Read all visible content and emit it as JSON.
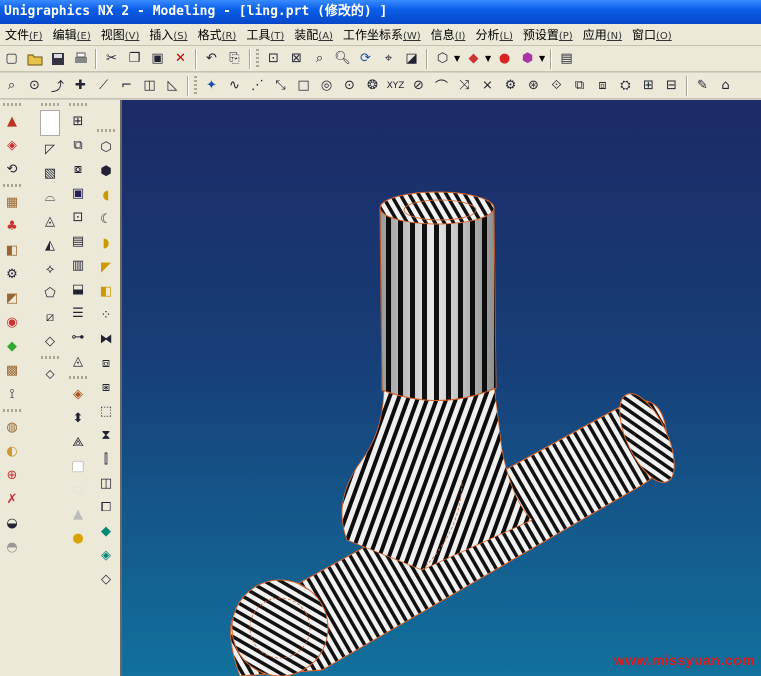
{
  "window": {
    "title": "Unigraphics NX 2 - Modeling - [ling.prt  (修改的) ]"
  },
  "menu": [
    {
      "label": "文件",
      "accel": "(F)"
    },
    {
      "label": "编辑",
      "accel": "(E)"
    },
    {
      "label": "视图",
      "accel": "(V)"
    },
    {
      "label": "插入",
      "accel": "(S)"
    },
    {
      "label": "格式",
      "accel": "(R)"
    },
    {
      "label": "工具",
      "accel": "(T)"
    },
    {
      "label": "装配",
      "accel": "(A)"
    },
    {
      "label": "工作坐标系",
      "accel": "(W)"
    },
    {
      "label": "信息",
      "accel": "(I)"
    },
    {
      "label": "分析",
      "accel": "(L)"
    },
    {
      "label": "预设置",
      "accel": "(P)"
    },
    {
      "label": "应用",
      "accel": "(N)"
    },
    {
      "label": "窗口",
      "accel": "(O)"
    }
  ],
  "toolbar1": {
    "icons": [
      "new-icon",
      "open-icon",
      "save-icon",
      "print-icon",
      "cut-icon",
      "copy-icon",
      "paste-icon",
      "delete-icon",
      "undo-icon",
      "redo-icon",
      "fit-icon",
      "zoom-window-icon",
      "zoom-icon",
      "rotate-icon",
      "pan-icon",
      "view-icon",
      "display-icon",
      "color-icon",
      "render-icon",
      "shade-icon",
      "layer-icon"
    ]
  },
  "toolbar2": {
    "icons": [
      "point-icon",
      "line-icon",
      "arc-icon",
      "spline-icon",
      "rectangle-icon",
      "circle-icon",
      "ellipse-icon",
      "polygon-icon",
      "sketch-icon",
      "curve-icon",
      "offset-icon",
      "trim-icon",
      "bridge-icon",
      "project-icon",
      "intersect-icon",
      "extract-icon",
      "wrap-icon",
      "extrude-icon",
      "revolve-icon",
      "sweep-icon",
      "mesh-icon",
      "fillet-icon"
    ]
  },
  "watermark": "www.missyuan.com",
  "colors": {
    "title_bar": "#0a5ee8",
    "viewport_top": "#1c2a66",
    "viewport_bottom": "#11709c",
    "edge_lines": "#e0652a",
    "watermark": "#d81c1c"
  }
}
